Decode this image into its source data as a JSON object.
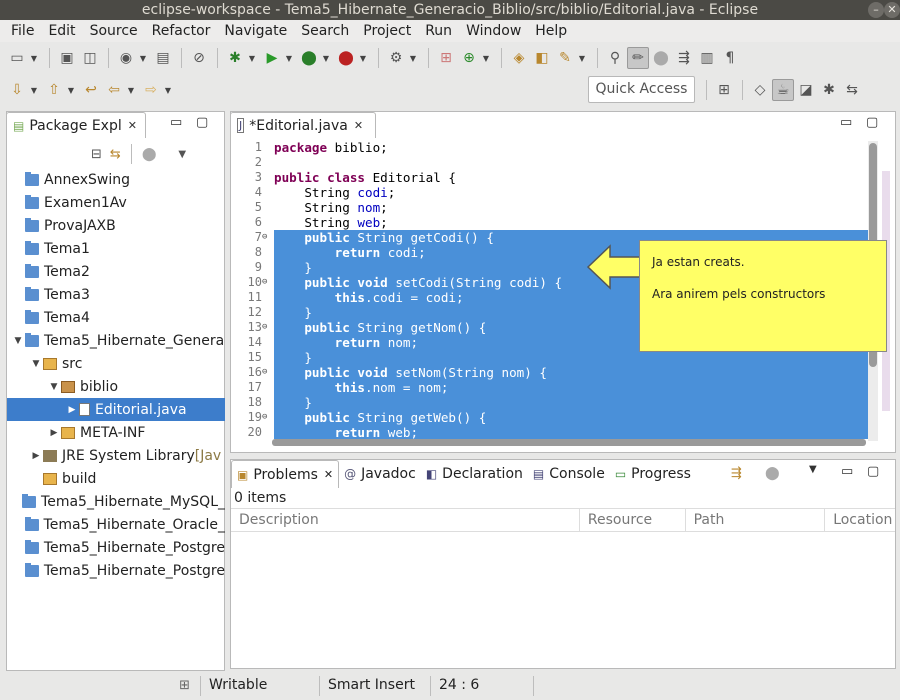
{
  "window": {
    "title": "eclipse-workspace - Tema5_Hibernate_Generacio_Biblio/src/biblio/Editorial.java - Eclipse",
    "min": "–",
    "close": "✕"
  },
  "menu": [
    "File",
    "Edit",
    "Source",
    "Refactor",
    "Navigate",
    "Search",
    "Project",
    "Run",
    "Window",
    "Help"
  ],
  "quick_access": "Quick Access",
  "package_explorer": {
    "tab_label": "Package Expl",
    "items": [
      {
        "label": "AnnexSwing",
        "icon": "project-icon",
        "indent": 0,
        "twisty": ""
      },
      {
        "label": "Examen1Av",
        "icon": "project-icon",
        "indent": 0,
        "twisty": ""
      },
      {
        "label": "ProvaJAXB",
        "icon": "project-icon",
        "indent": 0,
        "twisty": ""
      },
      {
        "label": "Tema1",
        "icon": "project-icon",
        "indent": 0,
        "twisty": ""
      },
      {
        "label": "Tema2",
        "icon": "project-icon",
        "indent": 0,
        "twisty": ""
      },
      {
        "label": "Tema3",
        "icon": "project-icon",
        "indent": 0,
        "twisty": ""
      },
      {
        "label": "Tema4",
        "icon": "project-icon",
        "indent": 0,
        "twisty": ""
      },
      {
        "label": "Tema5_Hibernate_Genera",
        "icon": "project-icon",
        "indent": 0,
        "twisty": "▼"
      },
      {
        "label": "src",
        "icon": "folder-icon",
        "indent": 1,
        "twisty": "▼"
      },
      {
        "label": "biblio",
        "icon": "package-icon",
        "indent": 2,
        "twisty": "▼"
      },
      {
        "label": "Editorial.java",
        "icon": "java-file-icon",
        "indent": 3,
        "twisty": "▶",
        "selected": true
      },
      {
        "label": "META-INF",
        "icon": "folder-icon",
        "indent": 2,
        "twisty": "▶"
      },
      {
        "label": "JRE System Library",
        "suffix": " [Jav",
        "icon": "library-icon",
        "indent": 1,
        "twisty": "▶"
      },
      {
        "label": "build",
        "icon": "folder-icon",
        "indent": 1,
        "twisty": ""
      },
      {
        "label": "Tema5_Hibernate_MySQL_",
        "icon": "project-icon",
        "indent": 0,
        "twisty": ""
      },
      {
        "label": "Tema5_Hibernate_Oracle_",
        "icon": "project-icon",
        "indent": 0,
        "twisty": ""
      },
      {
        "label": "Tema5_Hibernate_Postgre",
        "icon": "project-icon",
        "indent": 0,
        "twisty": ""
      },
      {
        "label": "Tema5_Hibernate_Postgre",
        "icon": "project-icon",
        "indent": 0,
        "twisty": ""
      }
    ]
  },
  "editor": {
    "tab_label": "*Editorial.java",
    "lines": [
      {
        "n": "1",
        "fold": "",
        "selected": false,
        "parts": [
          [
            "kw",
            "package"
          ],
          [
            "",
            "biblio;"
          ]
        ]
      },
      {
        "n": "2",
        "fold": "",
        "selected": false,
        "parts": []
      },
      {
        "n": "3",
        "fold": "",
        "selected": false,
        "parts": [
          [
            "kw",
            "public class"
          ],
          [
            "",
            "Editorial {"
          ]
        ]
      },
      {
        "n": "4",
        "fold": "",
        "selected": false,
        "parts": [
          [
            "",
            "    String "
          ],
          [
            "fld",
            "codi"
          ],
          [
            "",
            ";"
          ]
        ]
      },
      {
        "n": "5",
        "fold": "",
        "selected": false,
        "parts": [
          [
            "",
            "    String "
          ],
          [
            "fld",
            "nom"
          ],
          [
            "",
            ";"
          ]
        ]
      },
      {
        "n": "6",
        "fold": "",
        "selected": false,
        "parts": [
          [
            "",
            "    String "
          ],
          [
            "fld",
            "web"
          ],
          [
            "",
            ";"
          ]
        ]
      },
      {
        "n": "7",
        "fold": "⊖",
        "selected": true,
        "parts": [
          [
            "",
            "    "
          ],
          [
            "kw",
            "public"
          ],
          [
            "",
            " String getCodi() {"
          ]
        ]
      },
      {
        "n": "8",
        "fold": "",
        "selected": true,
        "parts": [
          [
            "",
            "        "
          ],
          [
            "kw",
            "return"
          ],
          [
            "",
            " codi;"
          ]
        ]
      },
      {
        "n": "9",
        "fold": "",
        "selected": true,
        "parts": [
          [
            "",
            "    }"
          ]
        ]
      },
      {
        "n": "10",
        "fold": "⊖",
        "selected": true,
        "parts": [
          [
            "",
            "    "
          ],
          [
            "kw",
            "public void"
          ],
          [
            "",
            " setCodi(String codi) {"
          ]
        ]
      },
      {
        "n": "11",
        "fold": "",
        "selected": true,
        "parts": [
          [
            "",
            "        "
          ],
          [
            "kw",
            "this"
          ],
          [
            "",
            ".codi = codi;"
          ]
        ]
      },
      {
        "n": "12",
        "fold": "",
        "selected": true,
        "parts": [
          [
            "",
            "    }"
          ]
        ]
      },
      {
        "n": "13",
        "fold": "⊖",
        "selected": true,
        "parts": [
          [
            "",
            "    "
          ],
          [
            "kw",
            "public"
          ],
          [
            "",
            " String getNom() {"
          ]
        ]
      },
      {
        "n": "14",
        "fold": "",
        "selected": true,
        "parts": [
          [
            "",
            "        "
          ],
          [
            "kw",
            "return"
          ],
          [
            "",
            " nom;"
          ]
        ]
      },
      {
        "n": "15",
        "fold": "",
        "selected": true,
        "parts": [
          [
            "",
            "    }"
          ]
        ]
      },
      {
        "n": "16",
        "fold": "⊖",
        "selected": true,
        "parts": [
          [
            "",
            "    "
          ],
          [
            "kw",
            "public void"
          ],
          [
            "",
            " setNom(String nom) {"
          ]
        ]
      },
      {
        "n": "17",
        "fold": "",
        "selected": true,
        "parts": [
          [
            "",
            "        "
          ],
          [
            "kw",
            "this"
          ],
          [
            "",
            ".nom = nom;"
          ]
        ]
      },
      {
        "n": "18",
        "fold": "",
        "selected": true,
        "parts": [
          [
            "",
            "    }"
          ]
        ]
      },
      {
        "n": "19",
        "fold": "⊖",
        "selected": true,
        "parts": [
          [
            "",
            "    "
          ],
          [
            "kw",
            "public"
          ],
          [
            "",
            " String getWeb() {"
          ]
        ]
      },
      {
        "n": "20",
        "fold": "",
        "selected": true,
        "parts": [
          [
            "",
            "        "
          ],
          [
            "kw",
            "return"
          ],
          [
            "",
            " web;"
          ]
        ]
      }
    ]
  },
  "callout": {
    "line1": "Ja estan creats.",
    "line2": "Ara anirem pels constructors"
  },
  "bottom": {
    "tabs": [
      {
        "label": "Problems",
        "icon": "problems-icon",
        "active": true
      },
      {
        "label": "Javadoc",
        "icon": "javadoc-icon"
      },
      {
        "label": "Declaration",
        "icon": "declaration-icon"
      },
      {
        "label": "Console",
        "icon": "console-icon"
      },
      {
        "label": "Progress",
        "icon": "progress-icon"
      }
    ],
    "items_count": "0 items",
    "columns": [
      "Description",
      "Resource",
      "Path",
      "Location"
    ]
  },
  "status": {
    "writable": "Writable",
    "insert_mode": "Smart Insert",
    "position": "24 : 6"
  },
  "colors": {
    "selection": "#4a90d9",
    "tree_selection": "#3d7dcb",
    "keyword": "#7f0055",
    "field": "#0000c0",
    "callout": "#ffff66"
  }
}
